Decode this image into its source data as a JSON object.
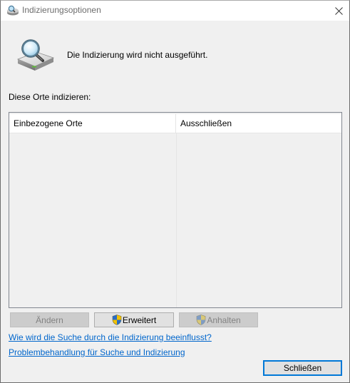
{
  "window": {
    "title": "Indizierungsoptionen",
    "close_icon": "close-icon"
  },
  "status": {
    "icon": "indexing-drive-magnifier-icon",
    "text": "Die Indizierung wird nicht ausgeführt."
  },
  "locations": {
    "label": "Diese Orte indizieren:",
    "columns": [
      "Einbezogene Orte",
      "Ausschließen"
    ],
    "rows": []
  },
  "buttons": {
    "aendern": "Ändern",
    "erweitert": "Erweitert",
    "anhalten": "Anhalten",
    "schliessen": "Schließen"
  },
  "links": {
    "how_indexing_affects": "Wie wird die Suche durch die Indizierung beeinflusst?",
    "troubleshoot": "Problembehandlung für Suche und Indizierung"
  },
  "colors": {
    "link": "#0066cc",
    "focus_border": "#0078d7"
  }
}
